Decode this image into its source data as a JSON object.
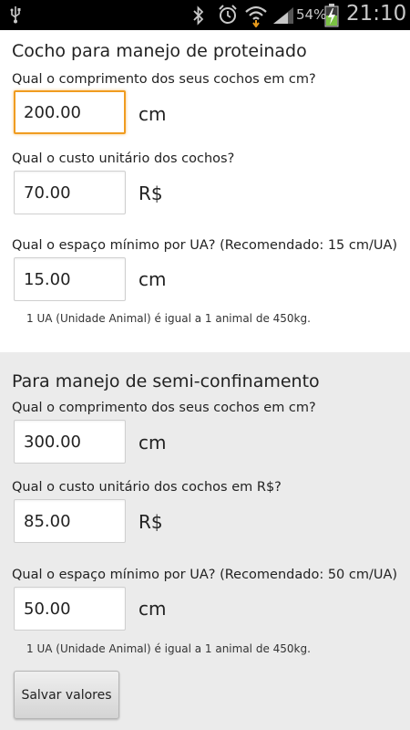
{
  "status_bar": {
    "icons": [
      "usb-icon",
      "bluetooth-icon",
      "alarm-icon",
      "wifi-icon",
      "signal-icon",
      "battery-charging-icon"
    ],
    "battery_percent": "54%",
    "time": "21:10"
  },
  "proteinado": {
    "title": "Cocho para manejo de proteinado",
    "length_label": "Qual o comprimento dos seus cochos em cm?",
    "length_value": "200.00",
    "length_unit": "cm",
    "cost_label": "Qual o custo unitário dos cochos?",
    "cost_value": "70.00",
    "cost_unit": "R$",
    "space_label": "Qual o espaço mínimo por UA? (Recomendado: 15 cm/UA)",
    "space_value": "15.00",
    "space_unit": "cm",
    "note": "1 UA (Unidade Animal) é igual a 1 animal de 450kg."
  },
  "semi_confinamento": {
    "title": "Para manejo de semi-confinamento",
    "length_label": "Qual o comprimento dos seus cochos em cm?",
    "length_value": "300.00",
    "length_unit": "cm",
    "cost_label": "Qual o custo unitário dos cochos em R$?",
    "cost_value": "85.00",
    "cost_unit": "R$",
    "space_label": "Qual o espaço mínimo por UA? (Recomendado: 50 cm/UA)",
    "space_value": "50.00",
    "space_unit": "cm",
    "note": "1 UA (Unidade Animal) é igual a 1 animal de 450kg."
  },
  "save_button_label": "Salvar valores",
  "colors": {
    "focus_border": "#f09c20",
    "status_bar_bg": "#000000",
    "battery_charging": "#7ac143",
    "download_arrow": "#e89a1c"
  }
}
